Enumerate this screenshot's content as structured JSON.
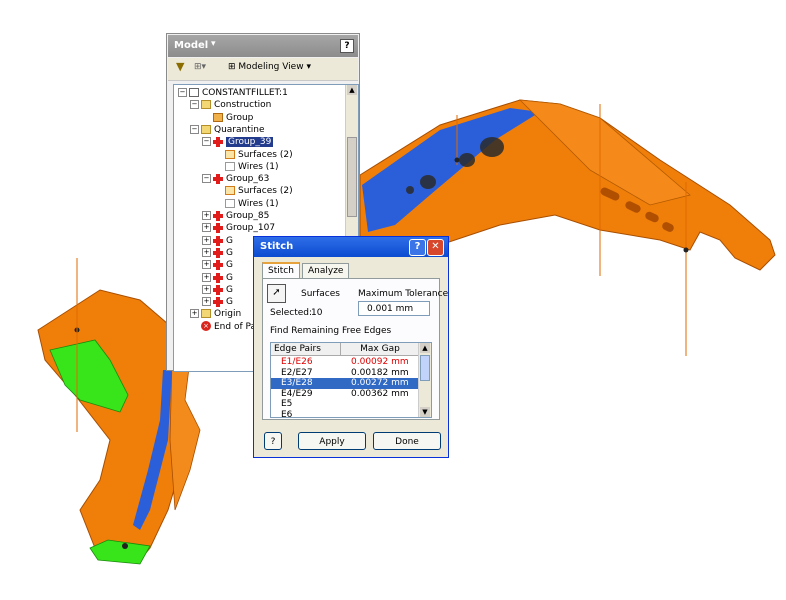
{
  "model": {
    "title": "Model",
    "help": "?",
    "toolbar": {
      "filter_icon": "funnel-icon",
      "view_label": "Modeling View"
    },
    "tree": [
      {
        "label": "CONSTANTFILLET:1",
        "icon": "part-icon",
        "expander": "−"
      },
      {
        "label": "Construction",
        "icon": "folder-icon",
        "expander": "−"
      },
      {
        "label": "Group",
        "icon": "group-icon",
        "expander": ""
      },
      {
        "label": "Quarantine",
        "icon": "folder-icon",
        "expander": "−"
      },
      {
        "label": "Group_39",
        "icon": "cross-icon",
        "expander": "−",
        "selected": true
      },
      {
        "label": "Surfaces (2)",
        "icon": "surface-icon",
        "expander": ""
      },
      {
        "label": "Wires (1)",
        "icon": "wire-icon",
        "expander": ""
      },
      {
        "label": "Group_63",
        "icon": "cross-icon",
        "expander": "−"
      },
      {
        "label": "Surfaces (2)",
        "icon": "surface-icon",
        "expander": ""
      },
      {
        "label": "Wires (1)",
        "icon": "wire-icon",
        "expander": ""
      },
      {
        "label": "Group_85",
        "icon": "cross-icon",
        "expander": "+"
      },
      {
        "label": "Group_107",
        "icon": "cross-icon",
        "expander": "+"
      },
      {
        "label": "G",
        "icon": "cross-icon",
        "expander": "+"
      },
      {
        "label": "G",
        "icon": "cross-icon",
        "expander": "+"
      },
      {
        "label": "G",
        "icon": "cross-icon",
        "expander": "+"
      },
      {
        "label": "G",
        "icon": "cross-icon",
        "expander": "+"
      },
      {
        "label": "G",
        "icon": "cross-icon",
        "expander": "+"
      },
      {
        "label": "G",
        "icon": "cross-icon",
        "expander": "+"
      },
      {
        "label": "Origin",
        "icon": "folder-icon",
        "expander": "+"
      },
      {
        "label": "End of Pa",
        "icon": "end-icon",
        "expander": ""
      }
    ]
  },
  "stitch": {
    "title": "Stitch",
    "help_btn": "?",
    "close_btn": "✕",
    "tabs": [
      "Stitch",
      "Analyze"
    ],
    "surfaces_label": "Surfaces",
    "selected_label": "Selected:",
    "selected_count": "10",
    "tolerance_label": "Maximum Tolerance",
    "tolerance_value": "0.001 mm",
    "free_edges_label": "Find Remaining Free Edges",
    "columns": [
      "Edge Pairs",
      "Max Gap"
    ],
    "rows": [
      {
        "pair": "E1/E26",
        "gap": "0.00092 mm",
        "state": "red"
      },
      {
        "pair": "E2/E27",
        "gap": "0.00182 mm",
        "state": ""
      },
      {
        "pair": "E3/E28",
        "gap": "0.00272 mm",
        "state": "sel"
      },
      {
        "pair": "E4/E29",
        "gap": "0.00362 mm",
        "state": ""
      },
      {
        "pair": "E5",
        "gap": "",
        "state": ""
      },
      {
        "pair": "E6",
        "gap": "",
        "state": ""
      }
    ],
    "apply": "Apply",
    "done": "Done",
    "footer_help": "?"
  },
  "colors": {
    "part": "#f07f0a",
    "part_dark": "#b85a00",
    "highlight_green": "#37e51a",
    "highlight_blue": "#2b5fd9"
  }
}
